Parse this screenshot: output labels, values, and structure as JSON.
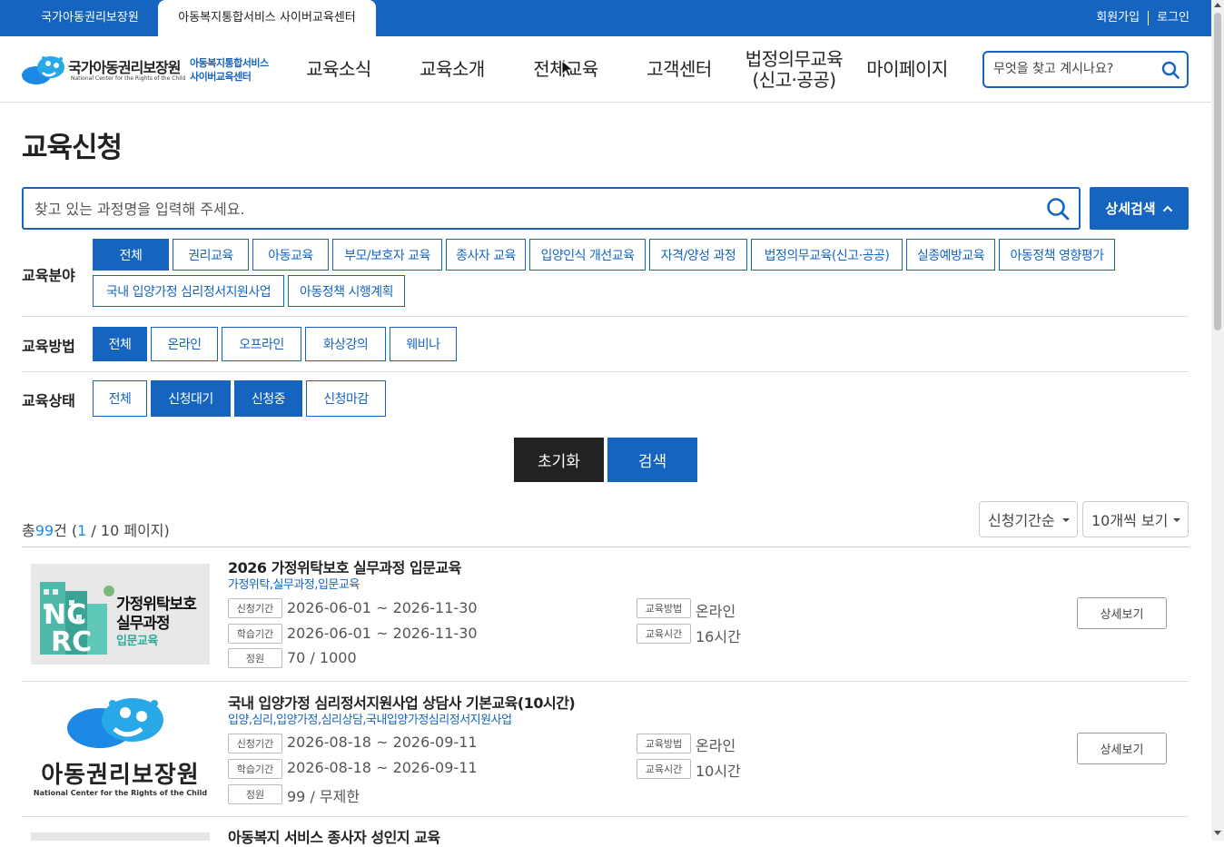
{
  "topbar": {
    "tab1": "국가아동권리보장원",
    "tab2": "아동복지통합서비스 사이버교육센터",
    "signup": "회원가입",
    "login": "로그인"
  },
  "logo": {
    "name": "국가아동권리보장원",
    "eng": "National Center for the Rights of the Child",
    "sub1": "아동복지통합서비스",
    "sub2": "사이버교육센터"
  },
  "nav": {
    "news": "교육소식",
    "intro": "교육소개",
    "all": "전체교육",
    "support": "고객센터",
    "legal1": "법정의무교육",
    "legal2": "(신고·공공)",
    "mypage": "마이페이지"
  },
  "search_top": {
    "placeholder": "무엇을 찾고 계시나요?"
  },
  "page": {
    "title": "교육신청"
  },
  "main_search": {
    "placeholder": "찾고 있는 과정명을 입력해 주세요.",
    "advanced": "상세검색"
  },
  "filters": {
    "field": {
      "label": "교육분야",
      "options": [
        "전체",
        "권리교육",
        "아동교육",
        "부모/보호자 교육",
        "종사자 교육",
        "입양인식 개선교육",
        "자격/양성 과정",
        "법정의무교육(신고·공공)",
        "실종예방교육",
        "아동정책 영향평가",
        "국내 입양가정 심리정서지원사업",
        "아동정책 시행계획"
      ]
    },
    "method": {
      "label": "교육방법",
      "options": [
        "전체",
        "온라인",
        "오프라인",
        "화상강의",
        "웨비나"
      ]
    },
    "status": {
      "label": "교육상태",
      "options": [
        "전체",
        "신청대기",
        "신청중",
        "신청마감"
      ]
    }
  },
  "actions": {
    "reset": "초기화",
    "search": "검색"
  },
  "summary": {
    "prefix": "총",
    "count": "99",
    "unit": "건 (",
    "page": "1",
    "pages": " / 10 페이지)"
  },
  "sort": {
    "order": "신청기간순",
    "per_page": "10개씩 보기"
  },
  "labels": {
    "apply_period": "신청기간",
    "study_period": "학습기간",
    "capacity": "정원",
    "method": "교육방법",
    "hours": "교육시간",
    "detail": "상세보기"
  },
  "courses": [
    {
      "title": "2026 가정위탁보호 실무과정 입문교육",
      "tags": "가정위탁,실무과정,입문교육",
      "apply": "2026-06-01 ~ 2026-11-30",
      "study": "2026-06-01 ~ 2026-11-30",
      "capacity": "70 / 1000",
      "method": "온라인",
      "hours": "16시간",
      "thumb_text1": "가정위탁보호",
      "thumb_text2": "실무과정",
      "thumb_text3": "입문교육"
    },
    {
      "title": "국내 입양가정 심리정서지원사업 상담사 기본교육(10시간)",
      "tags": "입양,심리,입양가정,심리상담,국내입양가정심리정서지원사업",
      "apply": "2026-08-18 ~ 2026-09-11",
      "study": "2026-08-18 ~ 2026-09-11",
      "capacity": "99 / 무제한",
      "method": "온라인",
      "hours": "10시간",
      "thumb_text1": "아동권리보장원",
      "thumb_text2": "National Center for the Rights of the Child"
    },
    {
      "title": "아동복지 서비스 종사자 성인지 교육"
    }
  ]
}
